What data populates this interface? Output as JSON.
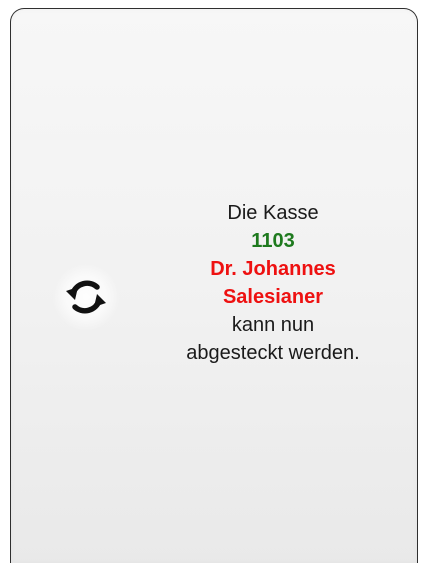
{
  "card": {
    "icon": "refresh-icon",
    "message": {
      "line1": "Die Kasse",
      "number": "1103",
      "name_line1": "Dr. Johannes",
      "name_line2": "Salesianer",
      "line4": "kann nun",
      "line5": "abgesteckt werden."
    }
  },
  "colors": {
    "number": "#1e7a1e",
    "name": "#ee1111",
    "text": "#1a1a1a",
    "border": "#2f2f2f"
  }
}
